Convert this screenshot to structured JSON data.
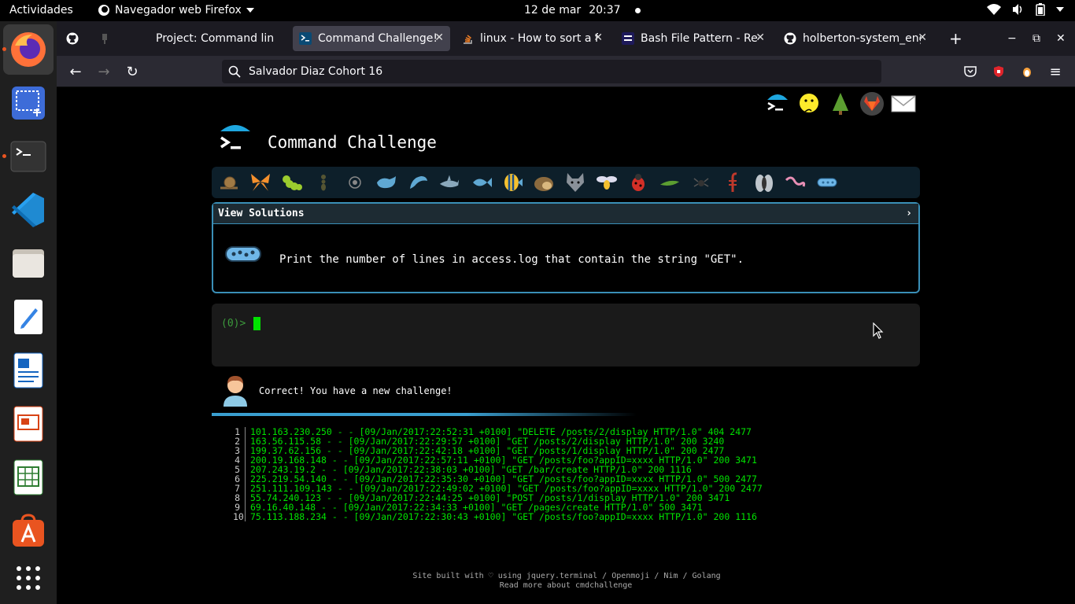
{
  "topbar": {
    "activities": "Actividades",
    "app_name": "Navegador web Firefox",
    "date": "12 de mar",
    "time": "20:37"
  },
  "dock": {
    "items": [
      "firefox-icon",
      "screenshot-icon",
      "terminal-icon",
      "vscode-icon",
      "files-icon",
      "text-editor-icon",
      "writer-icon",
      "impress-icon",
      "calc-icon",
      "software-center-icon",
      "app-grid-icon"
    ]
  },
  "browser": {
    "tabs": [
      {
        "label": "Project: Command line"
      },
      {
        "label": "Command Challenge!"
      },
      {
        "label": "linux - How to sort a fil"
      },
      {
        "label": "Bash File Pattern - Reg"
      },
      {
        "label": "holberton-system_eng"
      }
    ],
    "url": "Salvador Diaz Cohort 16"
  },
  "page": {
    "title": "Command Challenge",
    "solutions_label": "View Solutions",
    "solutions_arrow": "›",
    "task": "Print the number of lines in access.log that contain the string \"GET\".",
    "prompt": "(0)>",
    "correct_msg": "Correct! You have a new challenge!",
    "log_lines": [
      {
        "n": "1",
        "t": "101.163.230.250 - - [09/Jan/2017:22:52:31 +0100] \"DELETE /posts/2/display HTTP/1.0\" 404 2477"
      },
      {
        "n": "2",
        "t": "163.56.115.58 - - [09/Jan/2017:22:29:57 +0100] \"GET /posts/2/display HTTP/1.0\" 200 3240"
      },
      {
        "n": "3",
        "t": "199.37.62.156 - - [09/Jan/2017:22:42:18 +0100] \"GET /posts/1/display HTTP/1.0\" 200 2477"
      },
      {
        "n": "4",
        "t": "200.19.168.148 - - [09/Jan/2017:22:57:11 +0100] \"GET /posts/foo?appID=xxxx HTTP/1.0\" 200 3471"
      },
      {
        "n": "5",
        "t": "207.243.19.2 - - [09/Jan/2017:22:38:03 +0100] \"GET /bar/create HTTP/1.0\" 200 1116"
      },
      {
        "n": "6",
        "t": "225.219.54.140 - - [09/Jan/2017:22:35:30 +0100] \"GET /posts/foo?appID=xxxx HTTP/1.0\" 500 2477"
      },
      {
        "n": "7",
        "t": "251.111.109.143 - - [09/Jan/2017:22:49:02 +0100] \"GET /posts/foo?appID=xxxx HTTP/1.0\" 200 2477"
      },
      {
        "n": "8",
        "t": "55.74.240.123 - - [09/Jan/2017:22:44:25 +0100] \"POST /posts/1/display HTTP/1.0\" 200 3471"
      },
      {
        "n": "9",
        "t": "69.16.40.148 - - [09/Jan/2017:22:34:33 +0100] \"GET /pages/create HTTP/1.0\" 500 3471"
      },
      {
        "n": "10",
        "t": "75.113.188.234 - - [09/Jan/2017:22:30:43 +0100] \"GET /posts/foo?appID=xxxx HTTP/1.0\" 200 1116"
      }
    ],
    "footer_line1": "Site built with ♡ using jquery.terminal / Openmoji / Nim / Golang",
    "footer_line2": "Read more about cmdchallenge"
  },
  "colors": {
    "accent_blue": "#3a8fb7",
    "prompt_green": "#00e100",
    "log_green": "#00e400"
  }
}
